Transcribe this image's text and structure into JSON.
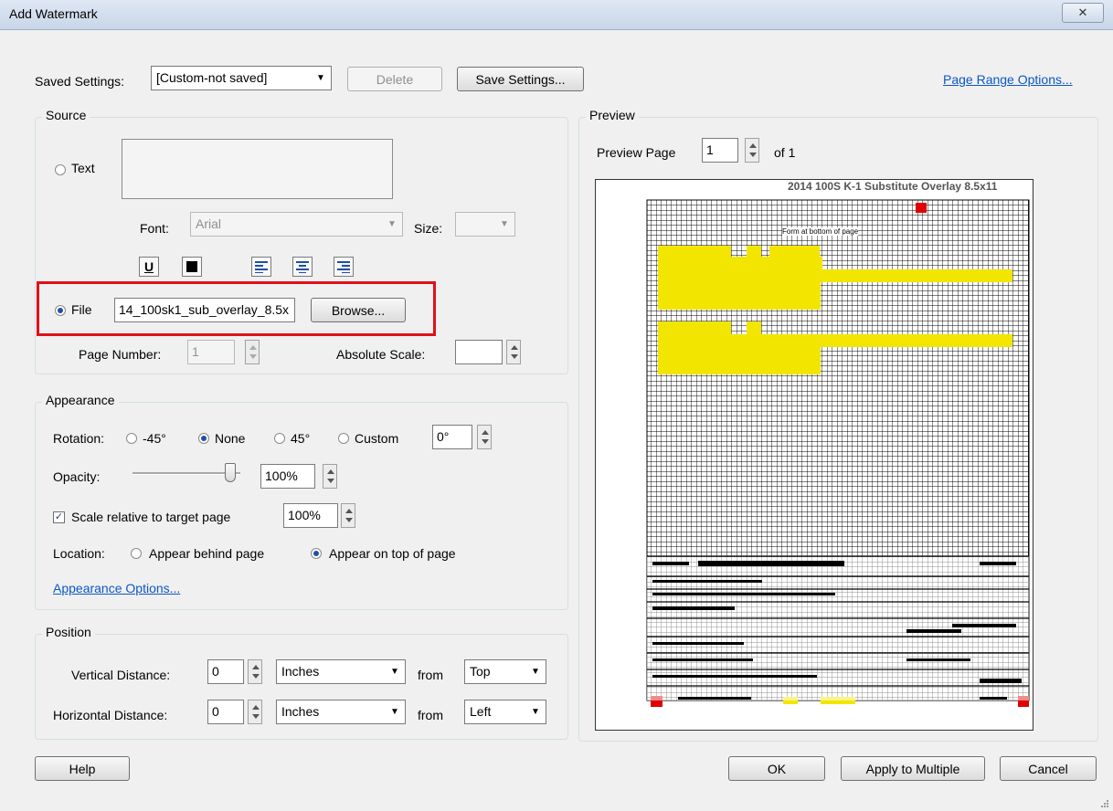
{
  "window": {
    "title": "Add Watermark",
    "close_glyph": "✕"
  },
  "saved_settings": {
    "label": "Saved Settings:",
    "value": "[Custom-not saved]",
    "delete_label": "Delete",
    "save_label": "Save Settings..."
  },
  "page_range_link": "Page Range Options...",
  "source": {
    "title": "Source",
    "text_label": "Text",
    "font_label": "Font:",
    "font_value": "Arial",
    "size_label": "Size:",
    "file_label": "File",
    "file_value": "14_100sk1_sub_overlay_8.5x",
    "browse_label": "Browse...",
    "page_number_label": "Page Number:",
    "page_number_value": "1",
    "absolute_scale_label": "Absolute Scale:",
    "underline_glyph": "U",
    "highlight_color": "#e0101a"
  },
  "appearance": {
    "title": "Appearance",
    "rotation_label": "Rotation:",
    "rot_m45": "-45°",
    "rot_none": "None",
    "rot_45": "45°",
    "rot_custom": "Custom",
    "rot_custom_value": "0°",
    "opacity_label": "Opacity:",
    "opacity_value": "100%",
    "scale_label": "Scale relative to target page",
    "scale_value": "100%",
    "scale_check_glyph": "✓",
    "location_label": "Location:",
    "loc_behind": "Appear behind page",
    "loc_top": "Appear on top of page",
    "options_link": "Appearance Options..."
  },
  "position": {
    "title": "Position",
    "vertical_label": "Vertical Distance:",
    "vertical_value": "0",
    "vertical_unit": "Inches",
    "from_label": "from",
    "vertical_from": "Top",
    "horizontal_label": "Horizontal Distance:",
    "horizontal_value": "0",
    "horizontal_unit": "Inches",
    "horizontal_from": "Left"
  },
  "preview": {
    "title": "Preview",
    "page_label": "Preview Page",
    "page_value": "1",
    "of_label": "of 1",
    "doc_title": "2014 100S K-1 Substitute Overlay 8.5x11",
    "doc_note": "Form at bottom of page",
    "grid_color": "#000000",
    "yellow": "#f2e600",
    "red": "#e00000"
  },
  "buttons": {
    "help": "Help",
    "ok": "OK",
    "apply_multiple": "Apply to Multiple",
    "cancel": "Cancel"
  }
}
